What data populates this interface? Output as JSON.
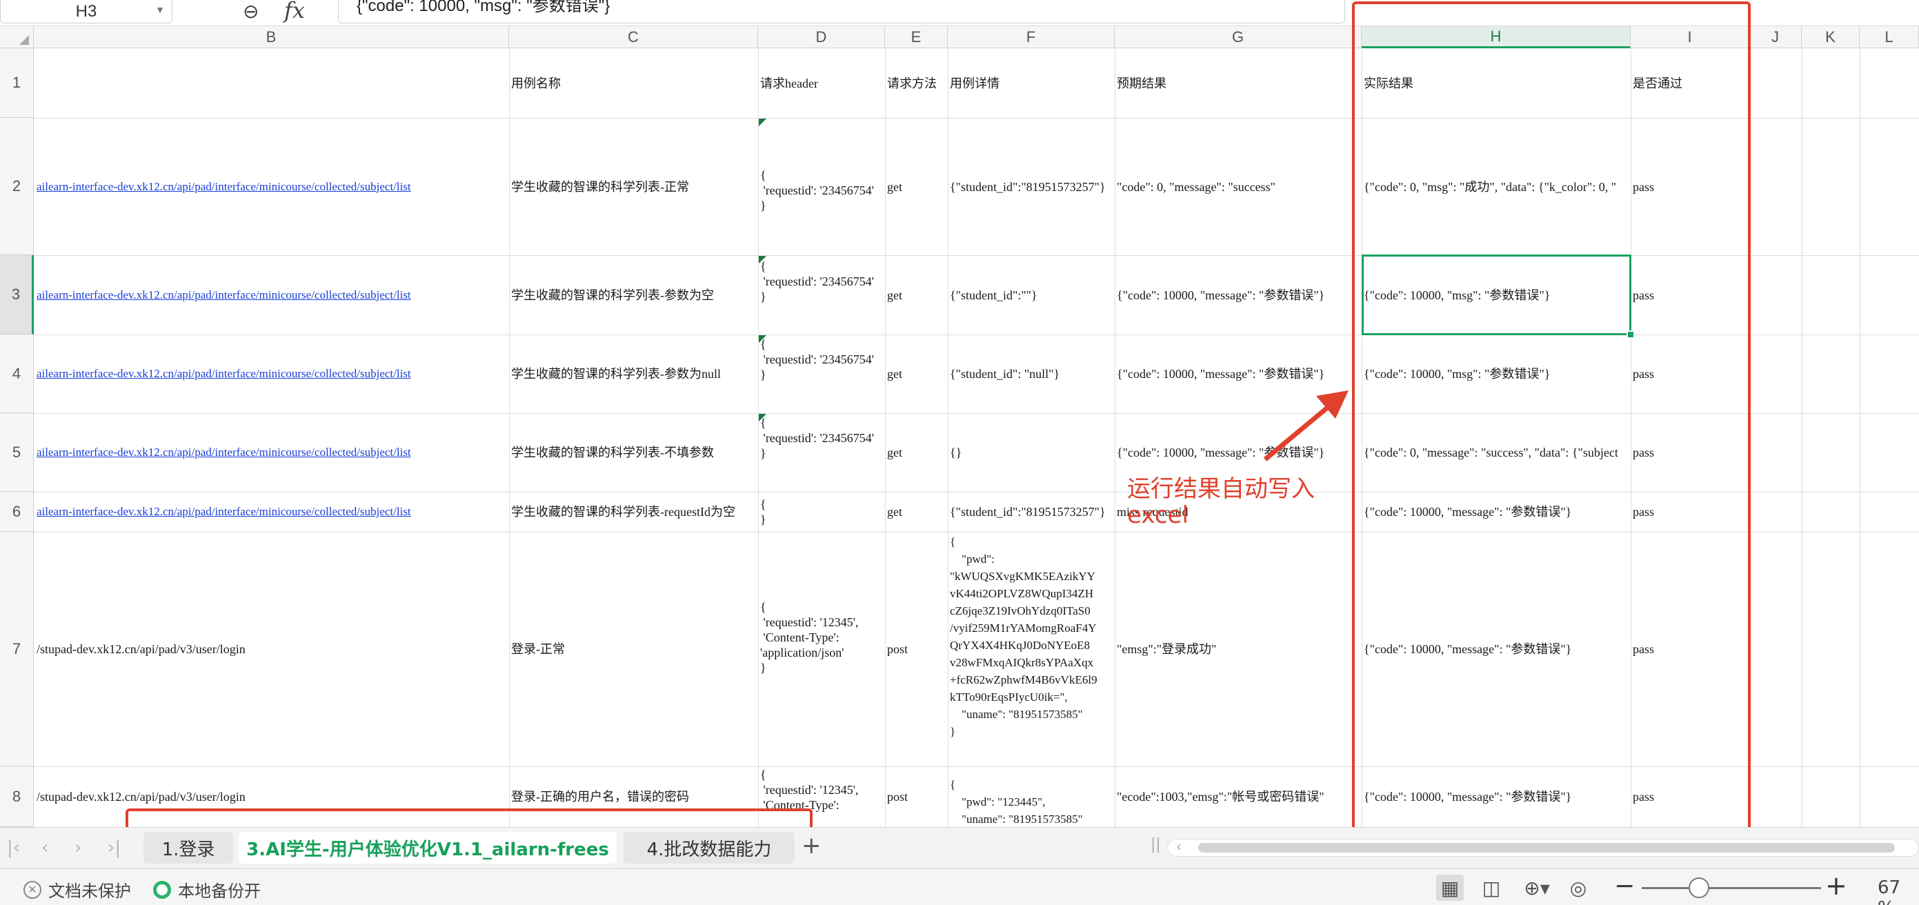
{
  "formula_bar": {
    "cell_ref": "H3",
    "formula": "{\"code\": 10000, \"msg\": \"参数错误\"}"
  },
  "columns": [
    "B",
    "C",
    "D",
    "E",
    "F",
    "G",
    "H",
    "I",
    "J",
    "K",
    "L"
  ],
  "active_column": "H",
  "active_row": "3",
  "rows": [
    "1",
    "2",
    "3",
    "4",
    "5",
    "6",
    "7",
    "8"
  ],
  "header_row": {
    "C": "用例名称",
    "D": "请求header",
    "E": "请求方法",
    "F": "用例详情",
    "G": "预期结果",
    "H": "实际结果",
    "I": "是否通过"
  },
  "data_rows": [
    {
      "url": "ailearn-interface-dev.xk12.cn/api/pad/interface/minicourse/collected/subject/list",
      "case_name": "学生收藏的智课的科学列表-正常",
      "header": "{\n 'requestid': '23456754'\n}",
      "method": "get",
      "detail": "{\"student_id\":\"81951573257\"}",
      "expected": "\"code\": 0, \"message\": \"success\"",
      "actual": "{\"code\": 0, \"msg\": \"成功\", \"data\": {\"k_color\": 0, \"",
      "passed": "pass"
    },
    {
      "url": "ailearn-interface-dev.xk12.cn/api/pad/interface/minicourse/collected/subject/list",
      "case_name": "学生收藏的智课的科学列表-参数为空",
      "header": "{\n 'requestid': '23456754'\n}",
      "method": "get",
      "detail": "{\"student_id\":\"\"}",
      "expected": "{\"code\": 10000, \"message\": \"参数错误\"}",
      "actual": "{\"code\": 10000, \"msg\": \"参数错误\"}",
      "passed": "pass"
    },
    {
      "url": "ailearn-interface-dev.xk12.cn/api/pad/interface/minicourse/collected/subject/list",
      "case_name": "学生收藏的智课的科学列表-参数为null",
      "header": "{\n 'requestid': '23456754'\n}",
      "method": "get",
      "detail": "{\"student_id\": \"null\"}",
      "expected": "{\"code\": 10000, \"message\": \"参数错误\"}",
      "actual": "{\"code\": 10000, \"msg\": \"参数错误\"}",
      "passed": "pass"
    },
    {
      "url": "ailearn-interface-dev.xk12.cn/api/pad/interface/minicourse/collected/subject/list",
      "case_name": "学生收藏的智课的科学列表-不填参数",
      "header": "{\n 'requestid': '23456754'\n}",
      "method": "get",
      "detail": "{}",
      "expected": "{\"code\": 10000, \"message\": \"参数错误\"}",
      "actual": "{\"code\": 0, \"message\": \"success\", \"data\": {\"subject",
      "passed": "pass"
    },
    {
      "url": "ailearn-interface-dev.xk12.cn/api/pad/interface/minicourse/collected/subject/list",
      "case_name": "学生收藏的智课的科学列表-requestId为空",
      "header": "{\n}",
      "method": "get",
      "detail": "{\"student_id\":\"81951573257\"}",
      "expected": "miss requestid",
      "actual": "{\"code\": 10000, \"message\": \"参数错误\"}",
      "passed": "pass"
    },
    {
      "url": "/stupad-dev.xk12.cn/api/pad/v3/user/login",
      "case_name": "登录-正常",
      "header": "{\n 'requestid': '12345',\n 'Content-Type':\n'application/json'\n}",
      "method": "post",
      "detail": "{\n    \"pwd\":\n\"kWUQSXvgKMK5EAzikYY\nvK44ti2OPLVZ8WQupI34ZH\ncZ6jqe3Z19IvOhYdzq0ITaS0\n/vyif259M1rYAMomgRoaF4Y\nQrYX4X4HKqJ0DoNYEoE8\nv28wFMxqAIQkr8sYPAaXqx\n+fcR62wZphwfM4B6vVkE6l9\nkTTo90rEqsPIycU0ik=\",\n    \"uname\": \"81951573585\"\n}",
      "expected": "\"emsg\":\"登录成功\"",
      "actual": "{\"code\": 10000, \"message\": \"参数错误\"}",
      "passed": "pass"
    },
    {
      "url": "/stupad-dev.xk12.cn/api/pad/v3/user/login",
      "case_name": "登录-正确的用户名，错误的密码",
      "header": "{\n 'requestid': '12345',\n 'Content-Type':",
      "method": "post",
      "detail": "{\n    \"pwd\": \"123445\",\n    \"uname\": \"81951573585\"",
      "expected": "\"ecode\":1003,\"emsg\":\"帐号或密码错误\"",
      "actual": "{\"code\": 10000, \"message\": \"参数错误\"}",
      "passed": "pass"
    }
  ],
  "annotation": {
    "text": "运行结果自动写入\nexcel",
    "color": "#e0412c"
  },
  "sheet_tabs": [
    "1.登录",
    "3.AI学生-用户体验优化V1.1_ailarn-frees",
    "4.批改数据能力"
  ],
  "active_sheet_index": 1,
  "add_sheet": "+",
  "status_bar": {
    "doc_protect": "文档未保护",
    "backup": "本地备份开",
    "zoom": "67 %"
  },
  "icons": {
    "formula_zoom": "magnifier-icon",
    "fx": "fx",
    "zoom_minus": "−",
    "zoom_plus": "+"
  },
  "colors": {
    "accent_green": "#1aa060",
    "link_blue": "#1a3fd6",
    "annotation_red": "#e0412c"
  }
}
